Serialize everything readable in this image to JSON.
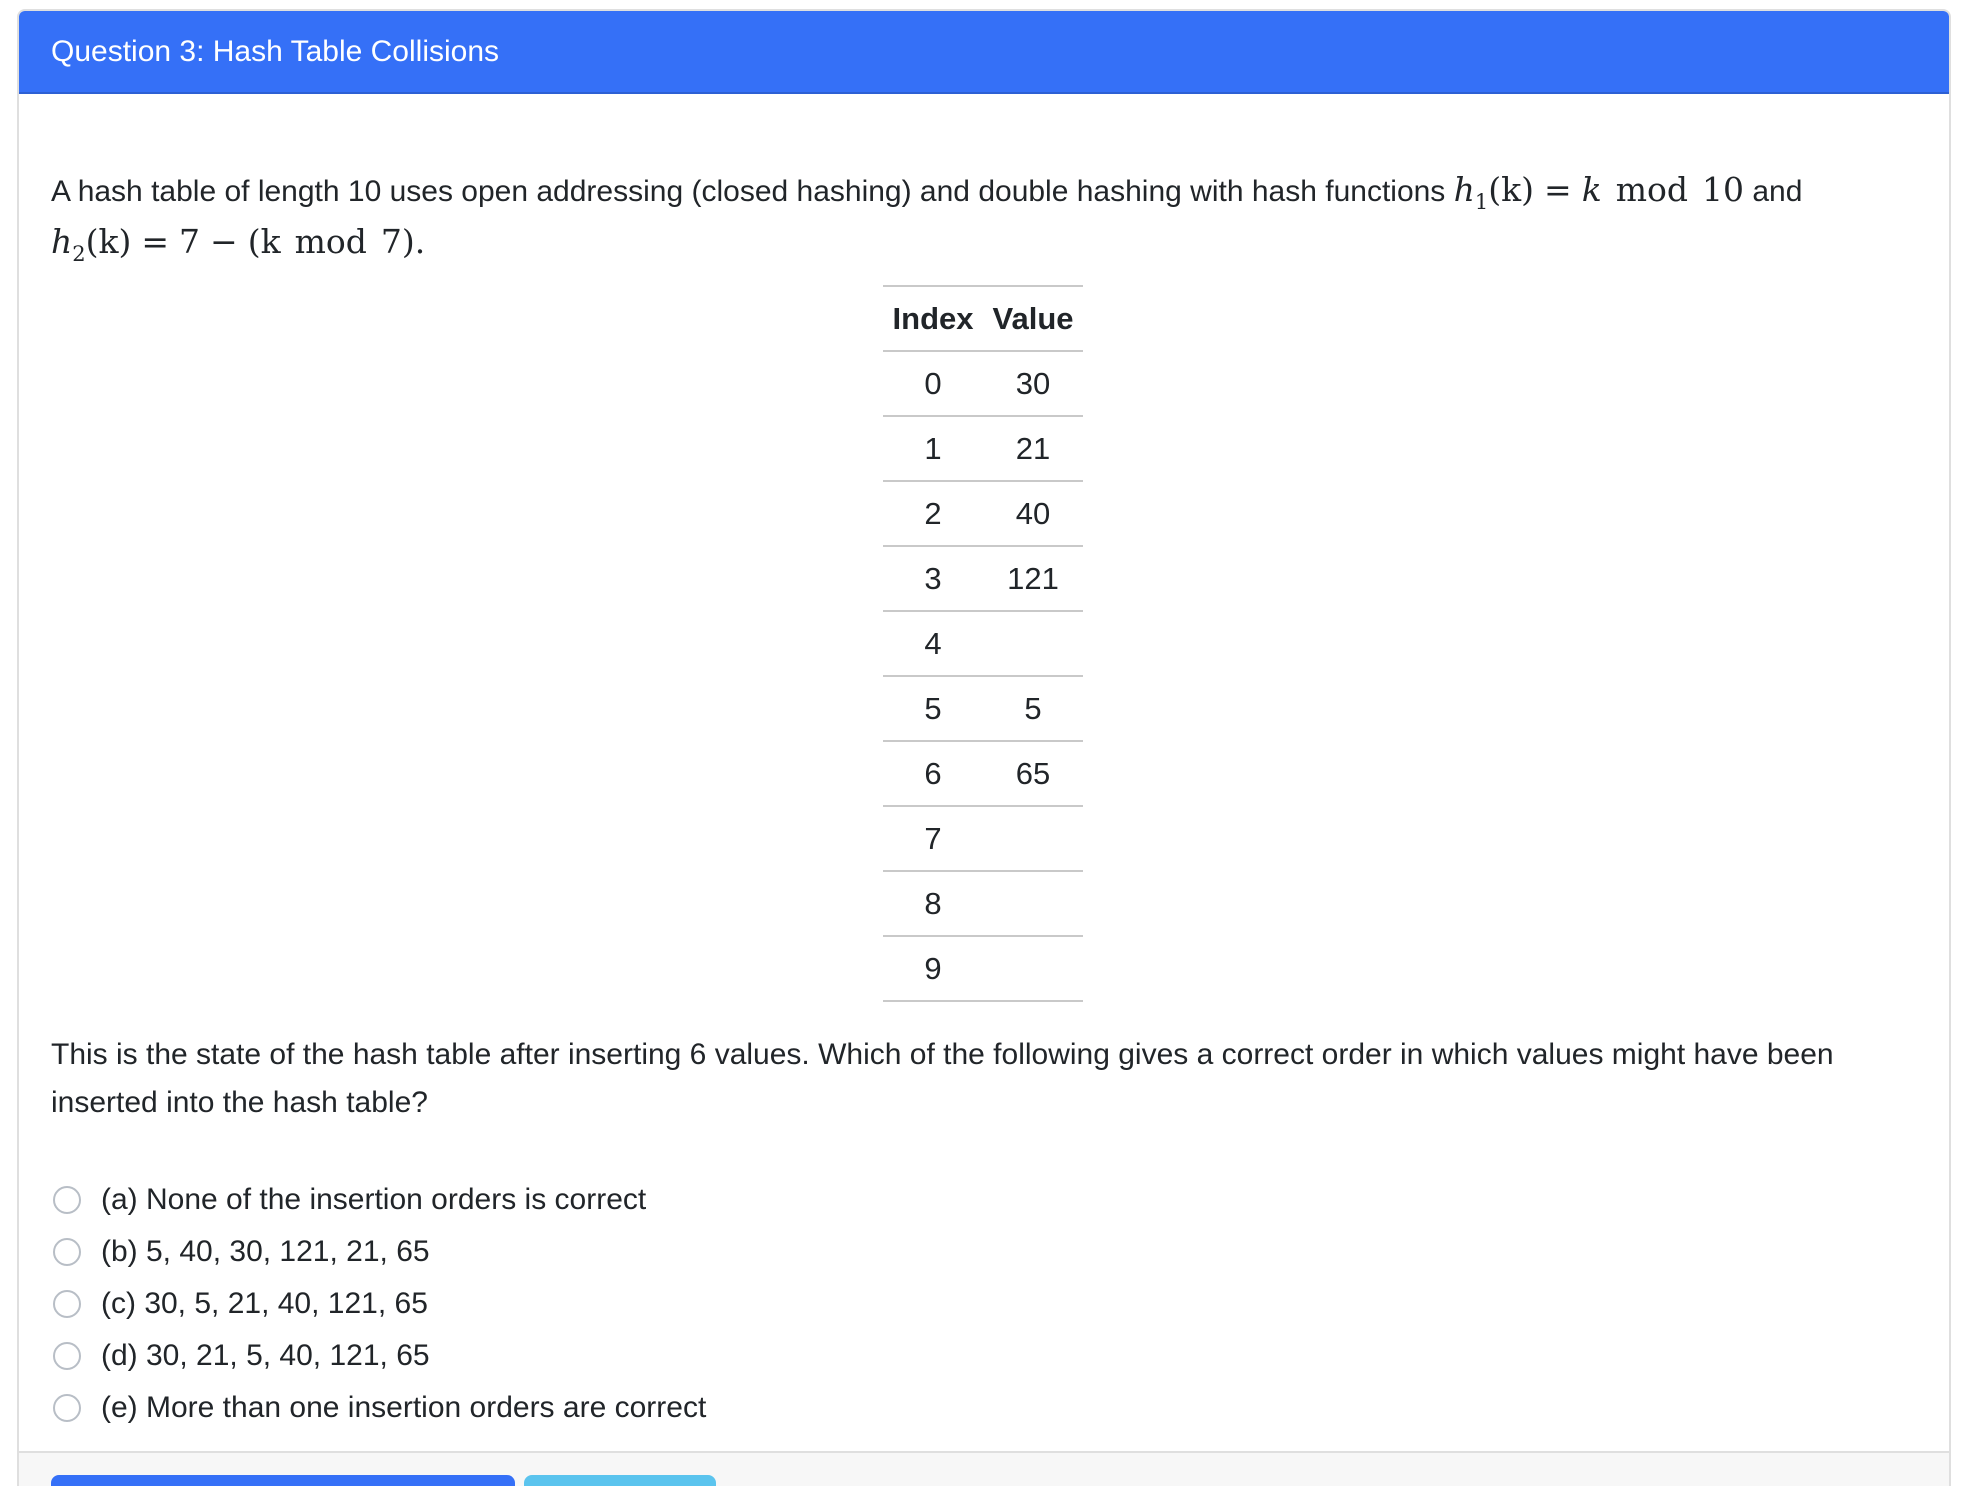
{
  "header": {
    "title": "Question 3: Hash Table Collisions"
  },
  "prompt": {
    "text_before": "A hash table of length 10 uses open addressing (closed hashing) and double hashing with hash functions",
    "h1": {
      "name": "h",
      "sub": "1",
      "arg": "(k)",
      "equals": "=",
      "k": "k",
      "op": "mod",
      "num": "10"
    },
    "and": "and",
    "h2": {
      "name": "h",
      "sub": "2",
      "arg": "(k)",
      "equals": "=",
      "seven": "7",
      "minus": "−",
      "open": "(k",
      "op": "mod",
      "close": "7)."
    }
  },
  "hash_table": {
    "headers": [
      "Index",
      "Value"
    ],
    "rows": [
      {
        "index": "0",
        "value": "30"
      },
      {
        "index": "1",
        "value": "21"
      },
      {
        "index": "2",
        "value": "40"
      },
      {
        "index": "3",
        "value": "121"
      },
      {
        "index": "4",
        "value": ""
      },
      {
        "index": "5",
        "value": "5"
      },
      {
        "index": "6",
        "value": "65"
      },
      {
        "index": "7",
        "value": ""
      },
      {
        "index": "8",
        "value": ""
      },
      {
        "index": "9",
        "value": ""
      }
    ]
  },
  "question": {
    "text": "This is the state of the hash table after inserting 6 values. Which of the following gives a correct order in which values might have been inserted into the hash table?"
  },
  "options": [
    {
      "label": "(a) None of the insertion orders is correct",
      "selected": false
    },
    {
      "label": "(b) 5, 40, 30, 121, 21, 65",
      "selected": false
    },
    {
      "label": "(c) 30, 5, 21, 40, 121, 65",
      "selected": false
    },
    {
      "label": "(d) 30, 21, 5, 40, 121, 65",
      "selected": false
    },
    {
      "label": "(e) More than one insertion orders are correct",
      "selected": false
    }
  ],
  "colors": {
    "header_bg": "#3570f7",
    "primary_button": "#3570f7",
    "info_button": "#5bc4ee"
  }
}
